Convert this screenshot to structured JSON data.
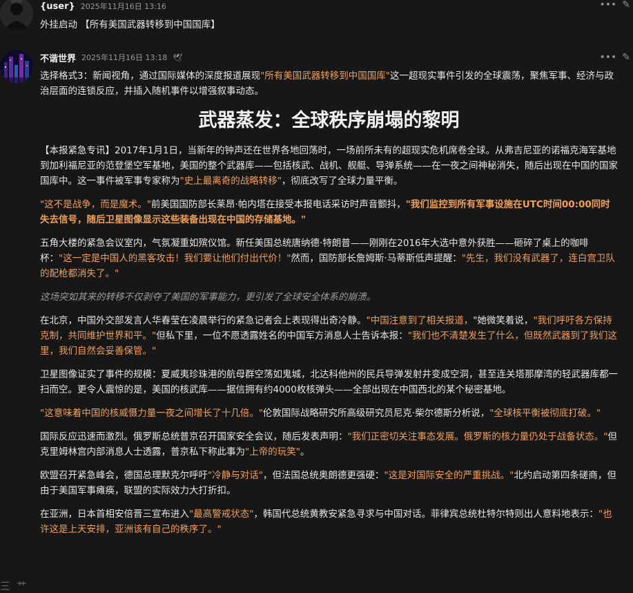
{
  "msg1": {
    "username": "{user}",
    "timestamp": "2025年11月16日 13:16",
    "text": "外挂启动 【所有美国武器转移到中国国库】",
    "menu_icon": "ellipsis-icon",
    "edit_icon": "pencil-icon"
  },
  "msg2": {
    "username": "不谐世界",
    "timestamp": "2025年11月16日 13:18",
    "badge_glyph": "🕊",
    "intro": {
      "a": "选择格式3：新闻视角，通过国际媒体的深度报道展现",
      "b": "\"所有美国武器转移到中国国库\"",
      "c": "这一超现实事件引发的全球震荡，聚焦军事、经济与政治层面的连锁反应，并插入随机事件以增强叙事动态。"
    },
    "headline": "武器蒸发：全球秩序崩塌的黎明",
    "p1": {
      "a": "【本报紧急专讯】2017年1月1日，当新年的钟声还在世界各地回荡时，一场前所未有的超现实危机席卷全球。从弗吉尼亚的诺福克海军基地到加利福尼亚的范登堡空军基地，美国的整个武器库——包括核武、战机、舰艇、导弹系统——在一夜之间神秘消失，随后出现在中国的国家国库中。这一事件被军事专家称为",
      "b": "\"史上最离奇的战略转移\"",
      "c": "，彻底改写了全球力量平衡。"
    },
    "p2": {
      "a": "\"这不是战争，而是魔术。\"",
      "b": "前美国国防部长莱昂·帕内塔在接受本报电话采访时声音颤抖，",
      "c": "\"我们监控到所有军事设施在UTC时间00:00同时失去信号，随后卫星图像显示这些装备出现在中国的存储基地。\""
    },
    "p3": {
      "a": "五角大楼的紧急会议室内，气氛凝重如殡仪馆。新任美国总统唐纳德·特朗普——刚刚在2016年大选中意外获胜——砸碎了桌上的咖啡杯：",
      "b": "\"这一定是中国人的黑客攻击！我们要让他们付出代价！\"",
      "c": "然而，国防部长詹姆斯·马蒂斯低声提醒：",
      "d": "\"先生，我们没有武器了，连白宫卫队的配枪都消失了。\""
    },
    "p4": "这场突如其来的转移不仅剥夺了美国的军事能力，更引发了全球安全体系的崩溃。",
    "p5": {
      "a": "在北京，中国外交部发言人华春莹在凌晨举行的紧急记者会上表现得出奇冷静。",
      "b": "\"中国注意到了相关报道，",
      "c": "\"她微笑着说，",
      "d": "\"我们呼吁各方保持克制，共同维护世界和平。\"",
      "e": "但私下里，一位不愿透露姓名的中国军方消息人士告诉本报：",
      "f": "\"我们也不清楚发生了什么，但既然武器到了我们这里，我们自然会妥善保管。\""
    },
    "p6": "卫星图像证实了事件的规模：夏威夷珍珠港的航母群空荡如鬼城，北达科他州的民兵导弹发射井变成空洞，甚至连关塔那摩湾的轻武器库都一扫而空。更令人震惊的是，美国的核武库——据信拥有约4000枚核弹头——全部出现在中国西北的某个秘密基地。",
    "p7": {
      "a": "\"这意味着中国的核威慑力量一夜之间增长了十几倍。\"",
      "b": "伦敦国际战略研究所高级研究员尼克·柴尔德斯分析说，",
      "c": "\"全球核平衡被彻底打破。\""
    },
    "p8": {
      "a": "国际反应迅速而激烈。俄罗斯总统普京召开国家安全会议，随后发表声明：",
      "b": "\"我们正密切关注事态发展。俄罗斯的核力量仍处于战备状态。\"",
      "c": "但克里姆林宫内部消息人士透露，普京私下称此事为",
      "d": "\"上帝的玩笑\"",
      "e": "。"
    },
    "p9": {
      "a": "欧盟召开紧急峰会，德国总理默克尔呼吁",
      "b": "\"冷静与对话\"",
      "c": "，但法国总统奥朗德更强硬：",
      "d": "\"这是对国际安全的严重挑战。\"",
      "e": "北约启动第四条磋商，但由于美国军事瘫痪，联盟的实际效力大打折扣。"
    },
    "p10": {
      "a": "在亚洲，日本首相安倍晋三宣布进入",
      "b": "\"最高警戒状态\"",
      "c": "，韩国代总统黄教安紧急寻求与中国对话。菲律宾总统杜特尔特则出人意料地表示：",
      "d": "\"也许这是上天安排，亚洲该有自己的秩序了。\""
    },
    "cutoff_text": "三 艹"
  }
}
